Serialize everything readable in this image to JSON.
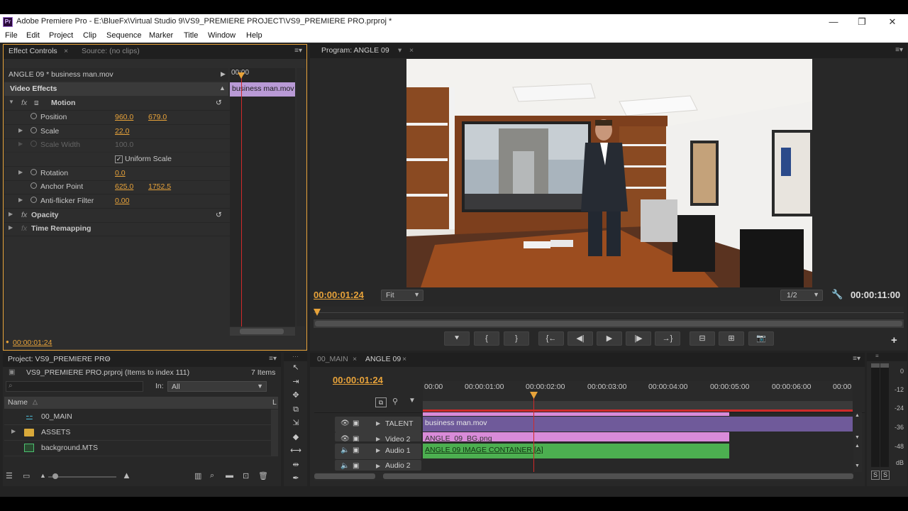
{
  "window": {
    "title": "Adobe Premiere Pro - E:\\BlueFx\\Virtual Studio 9\\VS9_PREMIERE PROJECT\\VS9_PREMIERE PRO.prproj *",
    "app_icon": "Pr",
    "minimize": "—",
    "maximize": "❐",
    "close": "✕"
  },
  "menu": [
    "File",
    "Edit",
    "Project",
    "Clip",
    "Sequence",
    "Marker",
    "Title",
    "Window",
    "Help"
  ],
  "effect_controls": {
    "tab_active": "Effect Controls",
    "tab_inactive": "Source: (no clips)",
    "clip_header": "ANGLE 09 * business man.mov",
    "ruler_time": "00:00",
    "clip_bar": "business man.mov",
    "section": "Video Effects",
    "timecode": "00:00:01:24",
    "rows": [
      {
        "label": "Motion",
        "kind": "effect"
      },
      {
        "label": "Position",
        "v1": "960.0",
        "v2": "679.0"
      },
      {
        "label": "Scale",
        "v1": "22.0"
      },
      {
        "label": "Scale Width",
        "v1": "100.0",
        "disabled": true
      },
      {
        "label": "Uniform Scale",
        "kind": "checkbox",
        "checked": true
      },
      {
        "label": "Rotation",
        "v1": "0.0"
      },
      {
        "label": "Anchor Point",
        "v1": "625.0",
        "v2": "1752.5"
      },
      {
        "label": "Anti-flicker Filter",
        "v1": "0.00"
      },
      {
        "label": "Opacity",
        "kind": "effect"
      },
      {
        "label": "Time Remapping",
        "kind": "effect"
      }
    ]
  },
  "program": {
    "tab": "Program: ANGLE 09",
    "timecode_left": "00:00:01:24",
    "fit": "Fit",
    "resolution": "1/2",
    "timecode_right": "00:00:11:00",
    "playhead_fraction": 0.0,
    "buttons": [
      "marker",
      "in",
      "out",
      "go-to-in",
      "step-back",
      "play",
      "step-forward",
      "go-to-out",
      "lift",
      "extract",
      "export-frame"
    ],
    "button_glyphs": [
      "⯆",
      "{",
      "}",
      "{←",
      "◀|",
      "▶",
      "|▶",
      "→}",
      "⊟",
      "⊞",
      "📷"
    ],
    "add": "+"
  },
  "project": {
    "tab": "Project: VS9_PREMIERE PRO",
    "file": "VS9_PREMIERE PRO.prproj (Items to index 111)",
    "items": "7 Items",
    "search_placeholder": "",
    "in_label": "In:",
    "in_value": "All",
    "col_name": "Name",
    "col_label": "L",
    "rows": [
      {
        "name": "00_MAIN",
        "icon": "sequence-icon"
      },
      {
        "name": "ASSETS",
        "icon": "folder-icon"
      },
      {
        "name": "background.MTS",
        "icon": "media-icon"
      }
    ]
  },
  "timeline": {
    "tab_inactive": "00_MAIN",
    "tab_active": "ANGLE 09",
    "timecode": "00:00:01:24",
    "ruler": [
      "00:00",
      "00:00:01:00",
      "00:00:02:00",
      "00:00:03:00",
      "00:00:04:00",
      "00:00:05:00",
      "00:00:06:00",
      "00:00"
    ],
    "tracks": [
      {
        "name": "TALENT",
        "type": "video"
      },
      {
        "name": "Video 2",
        "type": "video"
      },
      {
        "name": "Audio 1",
        "type": "audio"
      },
      {
        "name": "Audio 2",
        "type": "audio"
      }
    ],
    "clips": {
      "talent": "business man.mov",
      "video2": "ANGLE_09_BG.png",
      "audio1": "ANGLE 09 IMAGE CONTAINER [A]"
    },
    "colors": {
      "talent": "#6f5a9a",
      "pink": "#d98bd9",
      "green": "#4caf50"
    }
  },
  "meter": {
    "labels": [
      "0",
      "-12",
      "-24",
      "-36",
      "-48",
      "dB"
    ],
    "solo": [
      "S",
      "S"
    ]
  },
  "colors": {
    "accent": "#e8a33a",
    "panel": "#2d2d2d",
    "playhead": "#d02a2a"
  }
}
